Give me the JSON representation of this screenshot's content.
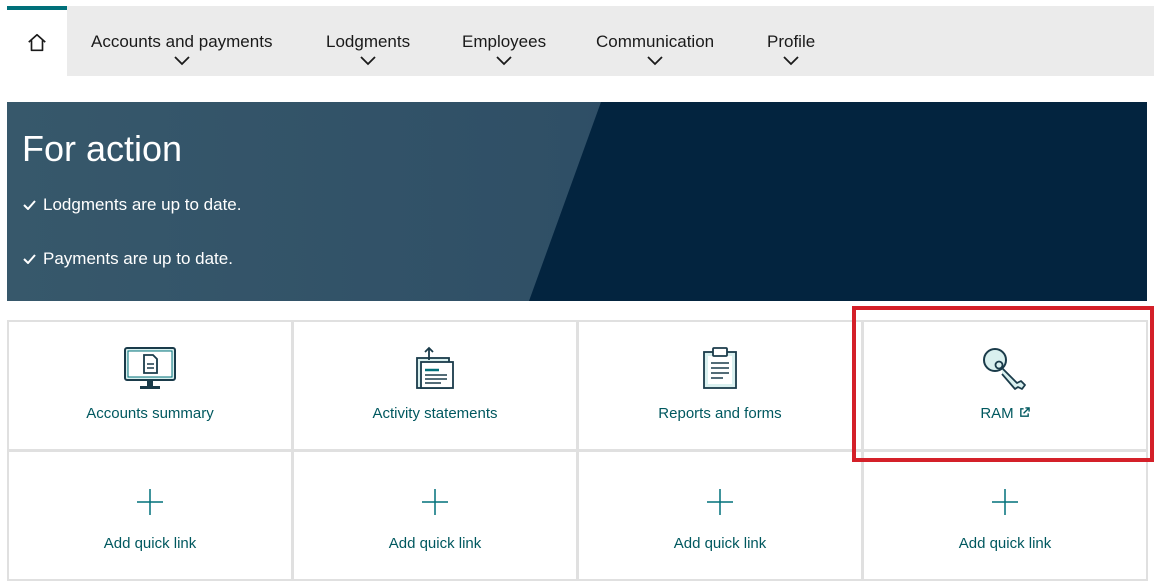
{
  "nav": {
    "home_icon": "home-icon",
    "items": [
      {
        "label": "Accounts and payments"
      },
      {
        "label": "Lodgments"
      },
      {
        "label": "Employees"
      },
      {
        "label": "Communication"
      },
      {
        "label": "Profile"
      }
    ]
  },
  "banner": {
    "title": "For action",
    "items": [
      "Lodgments are up to date.",
      "Payments are up to date."
    ]
  },
  "tiles": [
    {
      "label": "Accounts summary",
      "icon": "monitor-document-icon"
    },
    {
      "label": "Activity statements",
      "icon": "statements-upload-icon"
    },
    {
      "label": "Reports and forms",
      "icon": "clipboard-icon"
    },
    {
      "label": "RAM",
      "icon": "key-icon",
      "external": true
    },
    {
      "label": "Add quick link",
      "icon": "plus-icon"
    },
    {
      "label": "Add quick link",
      "icon": "plus-icon"
    },
    {
      "label": "Add quick link",
      "icon": "plus-icon"
    },
    {
      "label": "Add quick link",
      "icon": "plus-icon"
    }
  ],
  "colors": {
    "accent": "#00707a",
    "tile_text": "#00585f",
    "banner_dark": "#03243f",
    "highlight": "#d42029"
  }
}
